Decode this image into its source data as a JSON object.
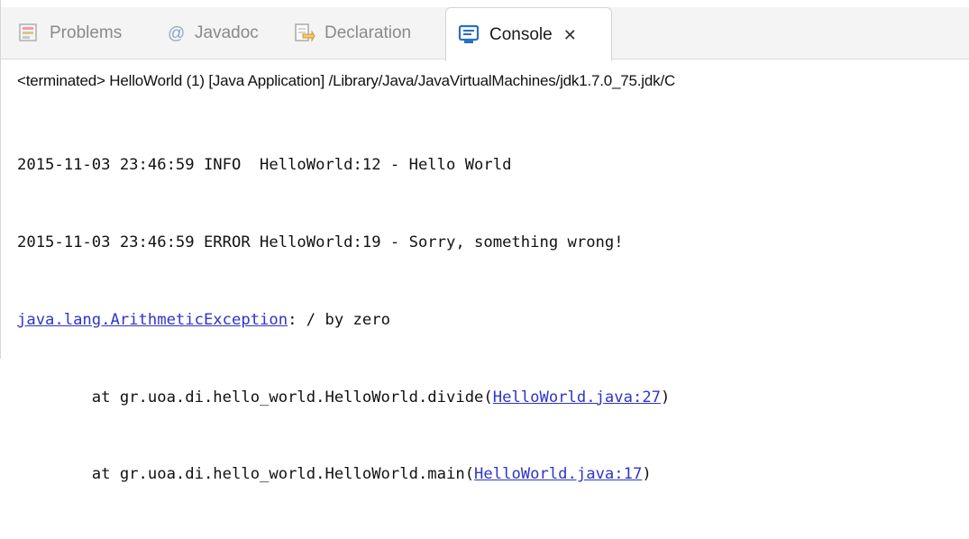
{
  "tabs": [
    {
      "label": "Problems",
      "icon": "problems-icon"
    },
    {
      "label": "Javadoc",
      "icon": "at-icon"
    },
    {
      "label": "Declaration",
      "icon": "declaration-icon"
    },
    {
      "label": "Console",
      "icon": "console-icon",
      "active": true
    }
  ],
  "console": {
    "close_glyph": "✕",
    "status": "<terminated> HelloWorld (1) [Java Application] /Library/Java/JavaVirtualMachines/jdk1.7.0_75.jdk/C",
    "lines": [
      {
        "text": "2015-11-03 23:46:59 INFO  HelloWorld:12 - Hello World"
      },
      {
        "text": "2015-11-03 23:46:59 ERROR HelloWorld:19 - Sorry, something wrong!"
      },
      {
        "link": "java.lang.ArithmeticException",
        "rest": ": / by zero"
      },
      {
        "prefix": "        at gr.uoa.di.hello_world.HelloWorld.divide(",
        "link": "HelloWorld.java:27",
        "suffix": ")"
      },
      {
        "prefix": "        at gr.uoa.di.hello_world.HelloWorld.main(",
        "link": "HelloWorld.java:17",
        "suffix": ")"
      }
    ]
  },
  "colors": {
    "link": "#2f34c9",
    "tab_active_text": "#1a1a1a",
    "tab_inactive_text": "#8a8a8a",
    "console_icon": "#2a6fc4"
  }
}
